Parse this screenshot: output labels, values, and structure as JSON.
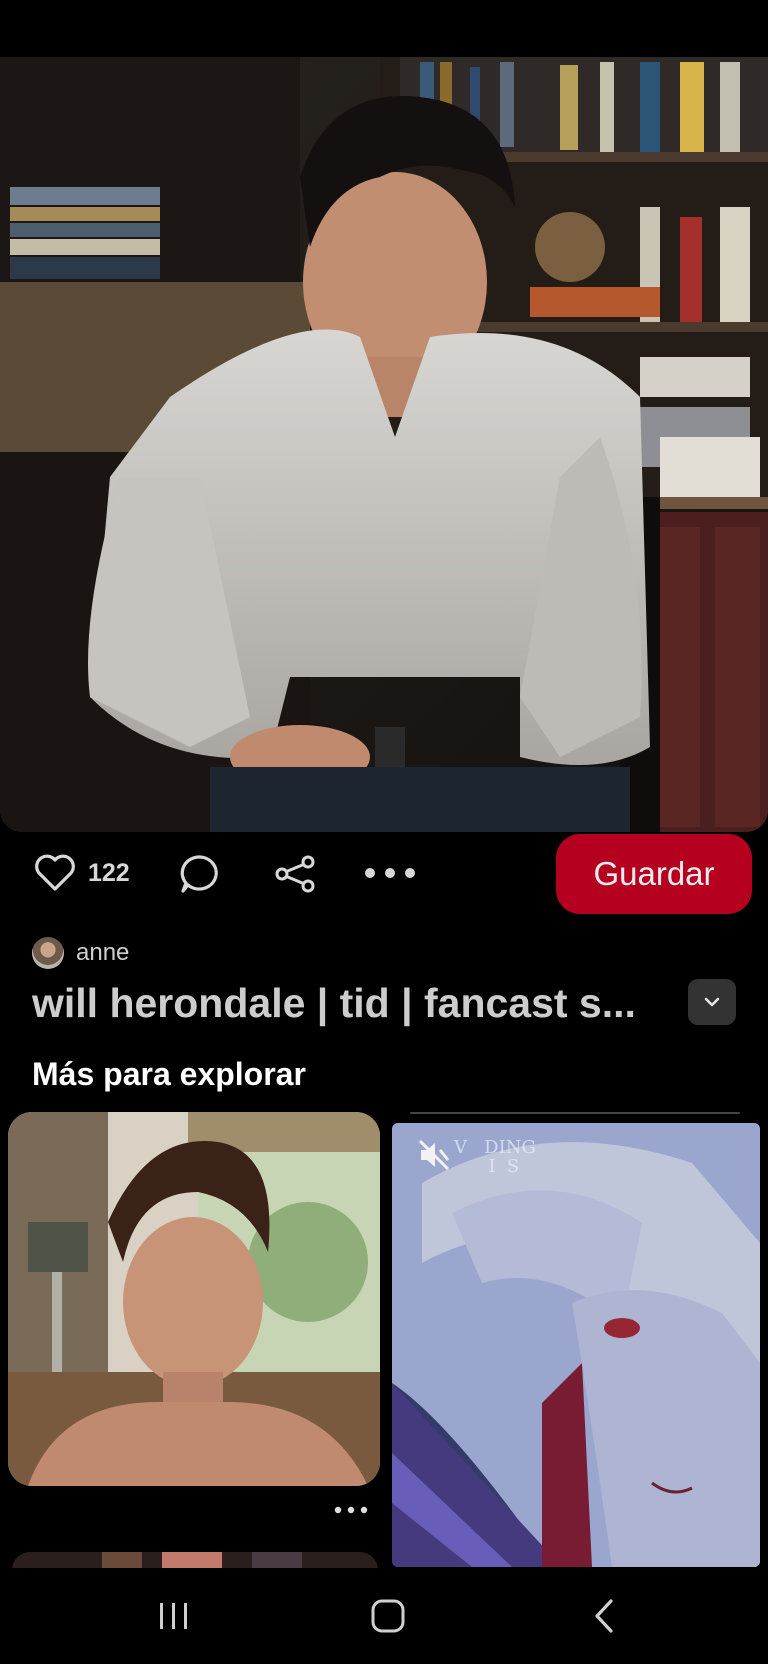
{
  "pin": {
    "image_alt": "Man in white shirt seated in front of bookshelves",
    "like_count": "122",
    "save_label": "Guardar",
    "author": "anne",
    "title": "will herondale | tid | fancast s..."
  },
  "explore": {
    "section_title": "Más para explorar",
    "cards": [
      {
        "image_alt": "Shirtless man in a room with lamp"
      },
      {
        "image_alt": "Anime character with white hair",
        "overlay_text": "V   DING\n      I  S",
        "muted": true
      }
    ]
  },
  "icons": {
    "like": "heart-icon",
    "comment": "comment-icon",
    "share": "share-icon",
    "more": "more-dots-icon",
    "expand": "chevron-down-icon",
    "mute": "muted-speaker-icon"
  },
  "colors": {
    "save_button": "#b6001f",
    "background": "#000000"
  }
}
